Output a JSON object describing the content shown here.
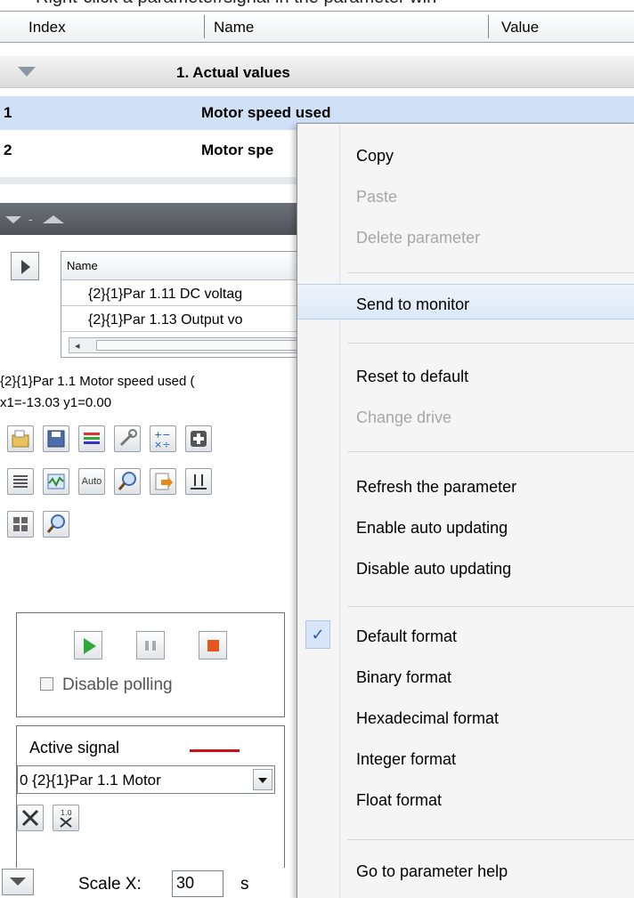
{
  "caption": "Right-click a parameter/signal in the parameter win",
  "grid": {
    "columns": [
      "Index",
      "Name",
      "Value"
    ],
    "group": "1. Actual values",
    "rows": [
      {
        "index": "1",
        "name": "Motor speed used"
      },
      {
        "index": "2",
        "name": "Motor spe"
      }
    ]
  },
  "monitor": {
    "table_header": "Name",
    "table_rows": [
      "{2}{1}Par 1.11 DC voltag",
      "{2}{1}Par 1.13 Output vo"
    ],
    "info_line1": "{2}{1}Par 1.1 Motor speed used (",
    "info_line2": "x1=-13.03 y1=0.00",
    "auto_label": "Auto",
    "disable_polling": "Disable polling",
    "active_signal": "Active signal",
    "signal_select": "0 {2}{1}Par 1.1 Motor",
    "scale_label": "Scale X:",
    "scale_value": "30",
    "scale_unit": "s",
    "signal_color": "#d10f16"
  },
  "context_menu": {
    "items": [
      "Copy",
      "Paste",
      "Delete parameter",
      "Send to monitor",
      "Reset to default",
      "Change drive",
      "Refresh the parameter",
      "Enable auto updating",
      "Disable auto updating",
      "Default format",
      "Binary format",
      "Hexadecimal format",
      "Integer format",
      "Float format",
      "Go to parameter help"
    ],
    "check_glyph": "✓"
  }
}
